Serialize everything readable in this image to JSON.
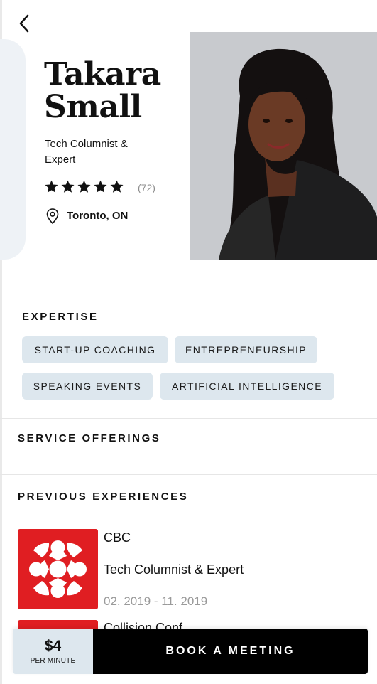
{
  "profile": {
    "name_line1": "Takara",
    "name_line2": "Small",
    "role": "Tech Columnist & Expert",
    "rating": 5,
    "rating_count": "(72)",
    "location": "Toronto, ON"
  },
  "expertise": {
    "title": "EXPERTISE",
    "tags": [
      "START-UP COACHING",
      "ENTREPRENEURSHIP",
      "SPEAKING EVENTS",
      "ARTIFICIAL INTELLIGENCE"
    ]
  },
  "services": {
    "title": "SERVICE OFFERINGS"
  },
  "experiences": {
    "title": "PREVIOUS EXPERIENCES",
    "items": [
      {
        "company": "CBC",
        "role": "Tech Columnist & Expert",
        "dates": "02. 2019 - 11. 2019",
        "logo": "cbc-gem-logo"
      },
      {
        "company": "Collision Conf",
        "logo": "red-logo"
      }
    ]
  },
  "booking": {
    "price": "$4",
    "price_unit": "PER MINUTE",
    "button_label": "BOOK A MEETING"
  },
  "colors": {
    "chip_bg": "#dde7ee",
    "cbc_red": "#e01e22",
    "button_bg": "#000000"
  },
  "icons": [
    "back-chevron-icon",
    "star-icon",
    "location-pin-icon"
  ]
}
